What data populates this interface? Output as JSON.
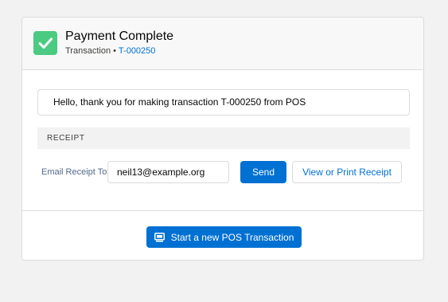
{
  "header": {
    "title": "Payment Complete",
    "subtitle_prefix": "Transaction",
    "subtitle_separator": "•",
    "transaction_link": "T-000250",
    "icon": "check-icon",
    "icon_color": "#4bca81"
  },
  "message": "Hello, thank you for making transaction T-000250 from POS",
  "receipt": {
    "section_label": "RECEIPT",
    "email_label": "Email Receipt To",
    "email_value": "neil13@example.org",
    "send_label": "Send",
    "print_label": "View or Print Receipt"
  },
  "footer": {
    "new_transaction_label": "Start a new POS Transaction",
    "icon": "pos-terminal-icon"
  },
  "colors": {
    "brand": "#0070d2",
    "success": "#4bca81",
    "border": "#dddbda",
    "background": "#f3f2f2"
  }
}
